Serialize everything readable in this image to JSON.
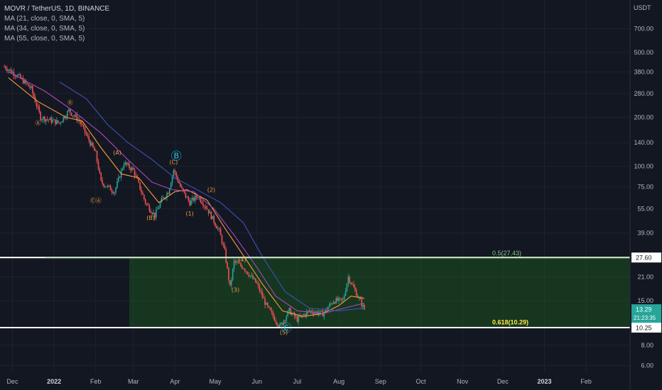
{
  "header": {
    "symbol": "MOVR / TetherUS, 1D, BINANCE",
    "indicators": [
      "MA (21, close, 0, SMA, 5)",
      "MA (34, close, 0, SMA, 5)",
      "MA (55, close, 0, SMA, 5)"
    ]
  },
  "price_axis": {
    "unit": "USDT"
  },
  "chart_data": {
    "type": "candlestick",
    "scale": "log",
    "ylim": [
      5.4,
      1050
    ],
    "y_ticks": [
      700,
      500,
      380,
      280,
      200,
      140,
      100,
      75,
      55,
      39,
      27,
      21,
      15,
      8,
      6
    ],
    "x_ticks": [
      "Dec",
      "2022",
      "Feb",
      "Mar",
      "Apr",
      "May",
      "Jun",
      "Jul",
      "Aug",
      "Sep",
      "Oct",
      "Nov",
      "Dec",
      "2023",
      "Feb"
    ],
    "price_path": [
      [
        410,
        "2021-11-25"
      ],
      [
        360,
        "2021-12-05"
      ],
      [
        300,
        "2021-12-15"
      ],
      [
        200,
        "2021-12-22"
      ],
      [
        185,
        "2022-01-05"
      ],
      [
        220,
        "2022-01-12"
      ],
      [
        190,
        "2022-01-20"
      ],
      [
        150,
        "2022-01-26"
      ],
      [
        120,
        "2022-02-01"
      ],
      [
        80,
        "2022-02-05"
      ],
      [
        70,
        "2022-02-15"
      ],
      [
        105,
        "2022-02-22"
      ],
      [
        95,
        "2022-03-01"
      ],
      [
        60,
        "2022-03-10"
      ],
      [
        50,
        "2022-03-17"
      ],
      [
        62,
        "2022-03-22"
      ],
      [
        70,
        "2022-03-27"
      ],
      [
        95,
        "2022-03-31"
      ],
      [
        72,
        "2022-04-06"
      ],
      [
        60,
        "2022-04-12"
      ],
      [
        66,
        "2022-04-18"
      ],
      [
        55,
        "2022-04-25"
      ],
      [
        40,
        "2022-05-04"
      ],
      [
        30,
        "2022-05-08"
      ],
      [
        18,
        "2022-05-12"
      ],
      [
        26,
        "2022-05-15"
      ],
      [
        24,
        "2022-05-22"
      ],
      [
        19,
        "2022-06-01"
      ],
      [
        14,
        "2022-06-08"
      ],
      [
        10.4,
        "2022-06-18"
      ],
      [
        13,
        "2022-06-25"
      ],
      [
        11.5,
        "2022-07-01"
      ],
      [
        13,
        "2022-07-10"
      ],
      [
        12.5,
        "2022-07-20"
      ],
      [
        15,
        "2022-07-28"
      ],
      [
        15,
        "2022-08-04"
      ],
      [
        21,
        "2022-08-08"
      ],
      [
        16,
        "2022-08-15"
      ],
      [
        13.29,
        "2022-08-20"
      ]
    ],
    "series": [
      {
        "name": "MA (21, close, 0, SMA, 5)",
        "color": "#f59e3a",
        "values": [
          [
            350,
            "2021-11-28"
          ],
          [
            250,
            "2021-12-20"
          ],
          [
            200,
            "2022-01-10"
          ],
          [
            190,
            "2022-01-22"
          ],
          [
            130,
            "2022-02-05"
          ],
          [
            90,
            "2022-02-20"
          ],
          [
            85,
            "2022-03-05"
          ],
          [
            60,
            "2022-03-20"
          ],
          [
            70,
            "2022-04-01"
          ],
          [
            72,
            "2022-04-10"
          ],
          [
            62,
            "2022-04-25"
          ],
          [
            42,
            "2022-05-08"
          ],
          [
            26,
            "2022-05-25"
          ],
          [
            19,
            "2022-06-05"
          ],
          [
            13,
            "2022-06-20"
          ],
          [
            12,
            "2022-07-05"
          ],
          [
            12.5,
            "2022-07-20"
          ],
          [
            14,
            "2022-08-01"
          ],
          [
            16,
            "2022-08-10"
          ],
          [
            15.5,
            "2022-08-20"
          ]
        ]
      },
      {
        "name": "MA (34, close, 0, SMA, 5)",
        "color": "#ab47bc",
        "values": [
          [
            380,
            "2021-11-28"
          ],
          [
            290,
            "2021-12-25"
          ],
          [
            220,
            "2022-01-15"
          ],
          [
            160,
            "2022-02-05"
          ],
          [
            110,
            "2022-02-25"
          ],
          [
            80,
            "2022-03-15"
          ],
          [
            72,
            "2022-03-30"
          ],
          [
            70,
            "2022-04-15"
          ],
          [
            55,
            "2022-04-30"
          ],
          [
            38,
            "2022-05-15"
          ],
          [
            24,
            "2022-06-01"
          ],
          [
            16,
            "2022-06-15"
          ],
          [
            13,
            "2022-07-01"
          ],
          [
            12.5,
            "2022-07-20"
          ],
          [
            13.5,
            "2022-08-05"
          ],
          [
            14.5,
            "2022-08-20"
          ]
        ]
      },
      {
        "name": "MA (55, close, 0, SMA, 5)",
        "color": "#3f51b5",
        "values": [
          [
            330,
            "2022-01-05"
          ],
          [
            260,
            "2022-01-25"
          ],
          [
            180,
            "2022-02-10"
          ],
          [
            140,
            "2022-02-25"
          ],
          [
            110,
            "2022-03-15"
          ],
          [
            85,
            "2022-04-01"
          ],
          [
            70,
            "2022-04-20"
          ],
          [
            60,
            "2022-05-05"
          ],
          [
            45,
            "2022-05-22"
          ],
          [
            28,
            "2022-06-05"
          ],
          [
            17,
            "2022-06-22"
          ],
          [
            13.5,
            "2022-07-10"
          ],
          [
            13,
            "2022-08-01"
          ],
          [
            13.5,
            "2022-08-20"
          ]
        ]
      }
    ],
    "wave_labels": [
      {
        "text": "Ⓐ",
        "color": "#f59e3a",
        "price": 180,
        "date": "2021-12-20"
      },
      {
        "text": "Ⓑ",
        "color": "#f59e3a",
        "price": 240,
        "date": "2022-01-13"
      },
      {
        "text": "(A)",
        "color": "#f59e3a",
        "price": 118,
        "date": "2022-02-17"
      },
      {
        "text": "ⒸⒶ",
        "color": "#f59e3a",
        "price": 60,
        "date": "2022-02-01"
      },
      {
        "text": "Ⓑ",
        "color": "#26c6da",
        "price": 110,
        "date": "2022-04-02"
      },
      {
        "text": "(C)",
        "color": "#f59e3a",
        "price": 103,
        "date": "2022-03-31"
      },
      {
        "text": "(B)",
        "color": "#f59e3a",
        "price": 47,
        "date": "2022-03-14"
      },
      {
        "text": "(1)",
        "color": "#f59e3a",
        "price": 50,
        "date": "2022-04-12"
      },
      {
        "text": "(2)",
        "color": "#f59e3a",
        "price": 70,
        "date": "2022-04-28"
      },
      {
        "text": "(4)",
        "color": "#f59e3a",
        "price": 26,
        "date": "2022-05-21"
      },
      {
        "text": "(3)",
        "color": "#f59e3a",
        "price": 17,
        "date": "2022-05-16"
      },
      {
        "text": "(5)",
        "color": "#f59e3a",
        "price": 9.3,
        "date": "2022-06-21"
      },
      {
        "text": "Ⓒ",
        "color": "#26c6da",
        "price": 9.7,
        "date": "2022-06-23"
      }
    ],
    "fib_levels": [
      {
        "label": "0.5(27.43)",
        "value": 27.43,
        "color": "#81c784"
      },
      {
        "label": "0.618(10.29)",
        "value": 10.29,
        "color": "#ffeb3b"
      }
    ],
    "horizontal_lines": [
      27.6,
      10.25
    ],
    "price_labels": [
      {
        "text": "27.60",
        "value": 27.6
      },
      {
        "text": "10.25",
        "value": 10.25
      }
    ],
    "last_price": {
      "value": 13.29,
      "text": "13.29",
      "countdown": "21:23:35",
      "color": "#26a69a"
    },
    "fill_zone": {
      "from": 10.25,
      "to": 27.6,
      "start_date": "2022-02-26",
      "color": "#1b5e20"
    },
    "colors": {
      "up": "#26a69a",
      "down": "#ef5350"
    },
    "grid": true
  }
}
